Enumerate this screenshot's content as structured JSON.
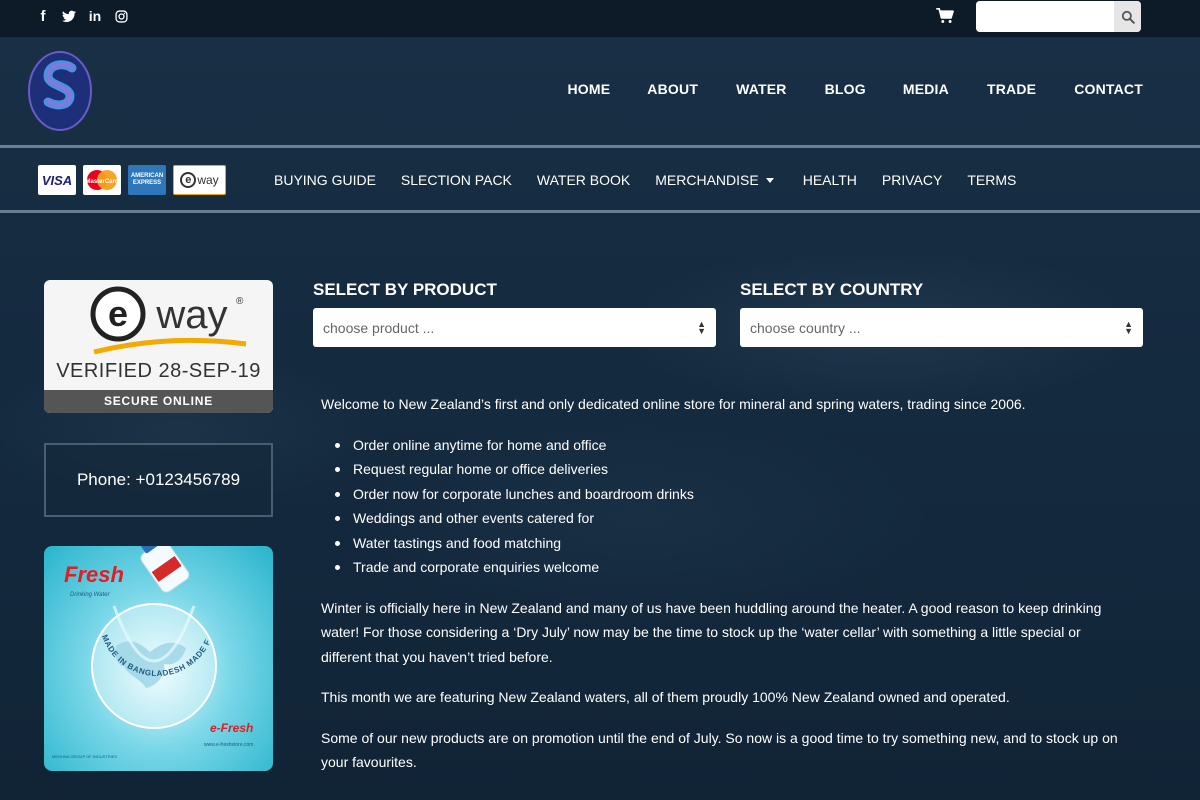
{
  "topbar": {
    "social": [
      {
        "name": "facebook-icon",
        "glyph": "f"
      },
      {
        "name": "twitter-icon",
        "glyph": ""
      },
      {
        "name": "linkedin-icon",
        "glyph": "in"
      },
      {
        "name": "instagram-icon",
        "glyph": ""
      }
    ],
    "cart_icon": "cart-icon",
    "search": {
      "value": "",
      "placeholder": "",
      "icon": "search-icon"
    }
  },
  "header": {
    "logo_icon": "brand-logo-s",
    "nav": [
      "HOME",
      "ABOUT",
      "WATER",
      "BLOG",
      "MEDIA",
      "TRADE",
      "CONTACT"
    ]
  },
  "subbar": {
    "cards": [
      "VISA",
      "MasterCard",
      "AMERICAN EXPRESS",
      "eway"
    ],
    "nav": [
      "BUYING GUIDE",
      "SLECTION PACK",
      "WATER BOOK",
      "MERCHANDISE",
      "HEALTH",
      "PRIVACY",
      "TERMS"
    ]
  },
  "sidebar": {
    "eway": {
      "logo": "eway",
      "trademark": "®",
      "verified": "VERIFIED 28-SEP-19",
      "secure": "SECURE ONLINE"
    },
    "phone": "Phone: +0123456789",
    "ad": {
      "brand": "Fresh",
      "tagline": "Drinking Water",
      "slogan": "MADE IN BANGLADESH MADE FOR THE WORLD",
      "footer_brand": "e-Fresh",
      "url": "www.e-freshstore.com",
      "group": "MEGHNA GROUP OF INDUSTRIES"
    }
  },
  "selectors": {
    "product": {
      "title": "SELECT BY PRODUCT",
      "value": "choose product ..."
    },
    "country": {
      "title": "SELECT BY COUNTRY",
      "value": "choose country ..."
    }
  },
  "content": {
    "intro": "Welcome to New Zealand’s first and only dedicated online store for mineral and spring waters, trading since 2006.",
    "bullets": [
      "Order online anytime for home and office",
      "Request regular home or office deliveries",
      "Order now for corporate lunches and boardroom drinks",
      "Weddings and other events catered for",
      "Water tastings and food matching",
      "Trade and corporate enquiries welcome"
    ],
    "para1": "Winter is officially here in New Zealand and many of us have been huddling around the heater. A good reason to keep drinking water! For those considering a ‘Dry July’ now may be the time to stock up the ‘water cellar’ with something a little special or different that you haven’t tried before.",
    "para2": "This month we are featuring New Zealand waters, all of them proudly 100% New Zealand owned and operated.",
    "para3": "Some of our new products are on promotion until the end of July. So now is a good time to try something new, and to stock up on your favourites."
  }
}
